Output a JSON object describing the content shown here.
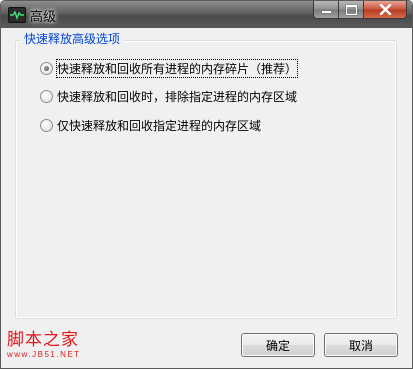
{
  "window": {
    "title": "高级"
  },
  "group": {
    "title": "快速释放高级选项",
    "options": [
      {
        "label": "快速释放和回收所有进程的内存碎片（推荐）",
        "checked": true
      },
      {
        "label": "快速释放和回收时，排除指定进程的内存区域",
        "checked": false
      },
      {
        "label": "仅快速释放和回收指定进程的内存区域",
        "checked": false
      }
    ]
  },
  "buttons": {
    "ok": "确定",
    "cancel": "取消"
  },
  "watermark": {
    "main": "脚本之家",
    "url": "www.JB51.NET"
  }
}
